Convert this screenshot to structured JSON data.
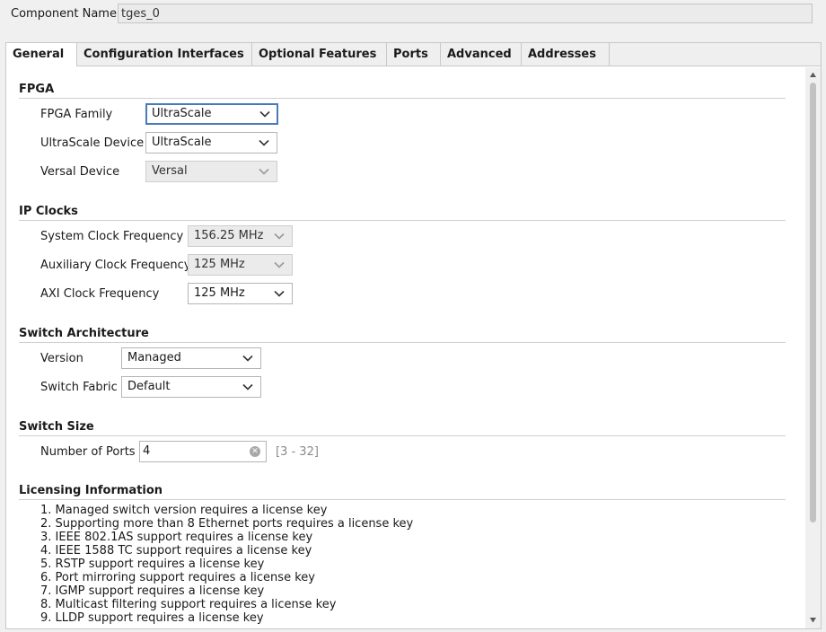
{
  "component": {
    "label": "Component Name",
    "value": "tges_0"
  },
  "tabs": [
    {
      "label": "General",
      "active": true
    },
    {
      "label": "Configuration Interfaces"
    },
    {
      "label": "Optional Features"
    },
    {
      "label": "Ports"
    },
    {
      "label": "Advanced"
    },
    {
      "label": "Addresses"
    }
  ],
  "fpga": {
    "title": "FPGA",
    "family_label": "FPGA Family",
    "family_value": "UltraScale",
    "ultrascale_label": "UltraScale Device",
    "ultrascale_value": "UltraScale",
    "versal_label": "Versal Device",
    "versal_value": "Versal"
  },
  "ip_clocks": {
    "title": "IP Clocks",
    "system_label": "System Clock Frequency",
    "system_value": "156.25 MHz",
    "aux_label": "Auxiliary Clock Frequency",
    "aux_value": "125 MHz",
    "axi_label": "AXI Clock Frequency",
    "axi_value": "125 MHz"
  },
  "switch_arch": {
    "title": "Switch Architecture",
    "version_label": "Version",
    "version_value": "Managed",
    "fabric_label": "Switch Fabric",
    "fabric_value": "Default"
  },
  "switch_size": {
    "title": "Switch Size",
    "ports_label": "Number of Ports",
    "ports_value": "4",
    "ports_range": "[3 - 32]"
  },
  "licensing": {
    "title": "Licensing Information",
    "items": [
      "1. Managed switch version requires a license key",
      "2. Supporting more than 8 Ethernet ports requires a license key",
      "3. IEEE 802.1AS support requires a license key",
      "4. IEEE 1588 TC support requires a license key",
      "5. RSTP support requires a license key",
      "6. Port mirroring support requires a license key",
      "7. IGMP support requires a license key",
      "8. Multicast filtering support requires a license key",
      "9. LLDP support requires a license key"
    ]
  },
  "icons": {
    "dropdown": "chevron-down-icon",
    "clear": "clear-icon",
    "scroll_up": "scroll-up-arrow-icon",
    "scroll_down": "scroll-down-arrow-icon"
  },
  "colors": {
    "focus_border": "#4b7ab8",
    "disabled_bg": "#ebebeb",
    "scroll_thumb": "#c2c2c2"
  }
}
